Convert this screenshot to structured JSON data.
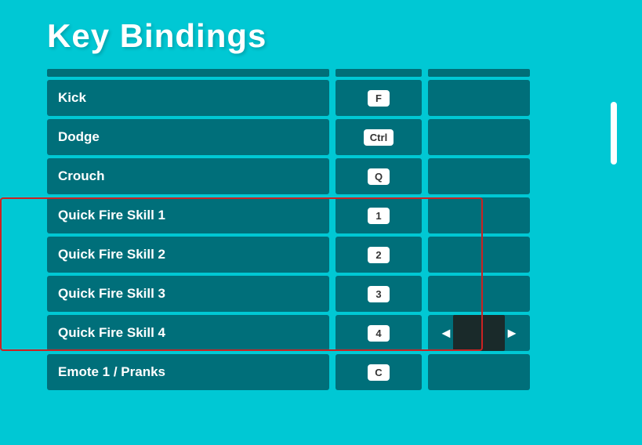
{
  "title": "Key Bindings",
  "columns": {
    "header_count": 3
  },
  "rows": [
    {
      "label": "Kick",
      "key": "F",
      "group": false
    },
    {
      "label": "Dodge",
      "key": "Ctrl",
      "group": false
    },
    {
      "label": "Crouch",
      "key": "Q",
      "group": false
    },
    {
      "label": "Quick Fire Skill 1",
      "key": "1",
      "group": true
    },
    {
      "label": "Quick Fire Skill 2",
      "key": "2",
      "group": true
    },
    {
      "label": "Quick Fire Skill 3",
      "key": "3",
      "group": true
    },
    {
      "label": "Quick Fire Skill 4",
      "key": "4",
      "group": true,
      "has_nav": true
    },
    {
      "label": "Emote 1 / Pranks",
      "key": "C",
      "group": false
    }
  ],
  "nav": {
    "left_arrow": "◄",
    "right_arrow": "►"
  }
}
